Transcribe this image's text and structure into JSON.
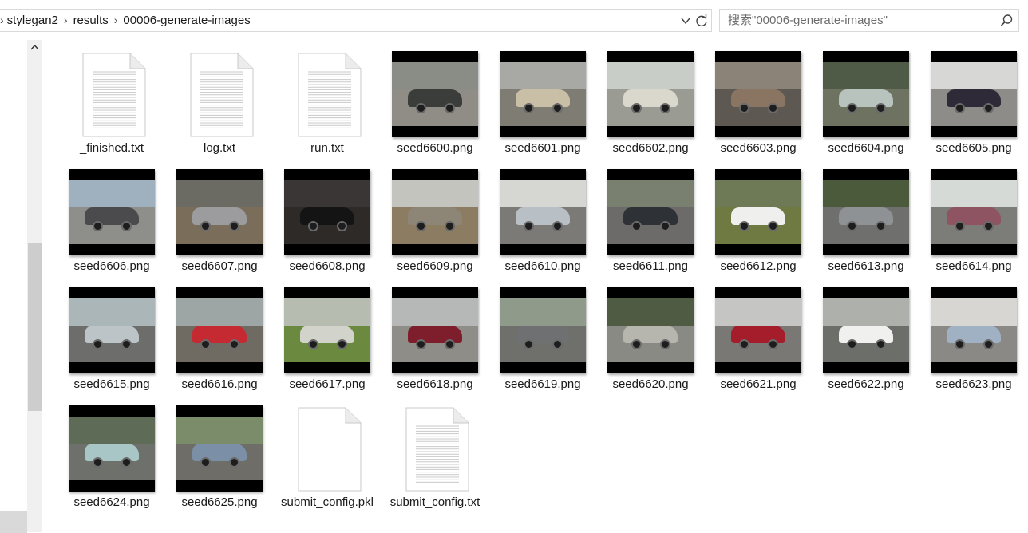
{
  "address": {
    "crumbs": [
      "stylegan2",
      "results",
      "00006-generate-images"
    ]
  },
  "search": {
    "placeholder": "搜索\"00006-generate-images\""
  },
  "files": [
    {
      "name": "_finished.txt",
      "kind": "text",
      "sky": "#ffffff",
      "ground": "#ffffff",
      "car": "#ffffff"
    },
    {
      "name": "log.txt",
      "kind": "text",
      "sky": "#ffffff",
      "ground": "#ffffff",
      "car": "#ffffff"
    },
    {
      "name": "run.txt",
      "kind": "text",
      "sky": "#ffffff",
      "ground": "#ffffff",
      "car": "#ffffff"
    },
    {
      "name": "seed6600.png",
      "kind": "image",
      "sky": "#8a8c86",
      "ground": "#8f8d86",
      "car": "#3a3d3a"
    },
    {
      "name": "seed6601.png",
      "kind": "image",
      "sky": "#a8a9a4",
      "ground": "#7f7c74",
      "car": "#c9bfa6"
    },
    {
      "name": "seed6602.png",
      "kind": "image",
      "sky": "#c9cdc7",
      "ground": "#9a9b92",
      "car": "#dad7cc"
    },
    {
      "name": "seed6603.png",
      "kind": "image",
      "sky": "#8b8377",
      "ground": "#5d5852",
      "car": "#8a7562"
    },
    {
      "name": "seed6604.png",
      "kind": "image",
      "sky": "#4f5b47",
      "ground": "#6d7360",
      "car": "#b9c3bd"
    },
    {
      "name": "seed6605.png",
      "kind": "image",
      "sky": "#d7d7d5",
      "ground": "#8e8c88",
      "car": "#2f2a37"
    },
    {
      "name": "seed6606.png",
      "kind": "image",
      "sky": "#9fb0bf",
      "ground": "#8e8f8b",
      "car": "#4b4a4d"
    },
    {
      "name": "seed6607.png",
      "kind": "image",
      "sky": "#6b6b63",
      "ground": "#7a6e5a",
      "car": "#9c9c9e"
    },
    {
      "name": "seed6608.png",
      "kind": "image",
      "sky": "#3a3635",
      "ground": "#2e2a28",
      "car": "#141414"
    },
    {
      "name": "seed6609.png",
      "kind": "image",
      "sky": "#c3c4bd",
      "ground": "#8c7d62",
      "car": "#8d8677"
    },
    {
      "name": "seed6610.png",
      "kind": "image",
      "sky": "#d6d6d2",
      "ground": "#7c7a77",
      "car": "#b8c0c6"
    },
    {
      "name": "seed6611.png",
      "kind": "image",
      "sky": "#79806f",
      "ground": "#6c6b69",
      "car": "#2e3136"
    },
    {
      "name": "seed6612.png",
      "kind": "image",
      "sky": "#6e7a55",
      "ground": "#6f7a43",
      "car": "#efefed"
    },
    {
      "name": "seed6613.png",
      "kind": "image",
      "sky": "#4a5a3b",
      "ground": "#6f6f6d",
      "car": "#8e9294"
    },
    {
      "name": "seed6614.png",
      "kind": "image",
      "sky": "#d5dad6",
      "ground": "#7c7d78",
      "car": "#8e5461"
    },
    {
      "name": "seed6615.png",
      "kind": "image",
      "sky": "#aab6b8",
      "ground": "#6d6e6c",
      "car": "#bcc4c8"
    },
    {
      "name": "seed6616.png",
      "kind": "image",
      "sky": "#9da6a4",
      "ground": "#6f6a62",
      "car": "#c52a33"
    },
    {
      "name": "seed6617.png",
      "kind": "image",
      "sky": "#b6bcaf",
      "ground": "#6b8a3f",
      "car": "#d2d4cc"
    },
    {
      "name": "seed6618.png",
      "kind": "image",
      "sky": "#b5b8b6",
      "ground": "#8e8d88",
      "car": "#7e1e2d"
    },
    {
      "name": "seed6619.png",
      "kind": "image",
      "sky": "#8f9a8b",
      "ground": "#6f6f6b",
      "car": "#6e7071"
    },
    {
      "name": "seed6620.png",
      "kind": "image",
      "sky": "#505b43",
      "ground": "#8a8a85",
      "car": "#b7b6ae"
    },
    {
      "name": "seed6621.png",
      "kind": "image",
      "sky": "#c5c6c3",
      "ground": "#7a7875",
      "car": "#a51d2b"
    },
    {
      "name": "seed6622.png",
      "kind": "image",
      "sky": "#aeb1ab",
      "ground": "#6c6e6a",
      "car": "#f0f0ee"
    },
    {
      "name": "seed6623.png",
      "kind": "image",
      "sky": "#d7d6d3",
      "ground": "#8a8985",
      "car": "#9fb1c3"
    },
    {
      "name": "seed6624.png",
      "kind": "image",
      "sky": "#5e6b56",
      "ground": "#6e706b",
      "car": "#a9c6c6"
    },
    {
      "name": "seed6625.png",
      "kind": "image",
      "sky": "#7a8c6a",
      "ground": "#6e6d68",
      "car": "#7b8fa6"
    },
    {
      "name": "submit_config.pkl",
      "kind": "blank",
      "sky": "#ffffff",
      "ground": "#ffffff",
      "car": "#ffffff"
    },
    {
      "name": "submit_config.txt",
      "kind": "text",
      "sky": "#ffffff",
      "ground": "#ffffff",
      "car": "#ffffff"
    }
  ]
}
